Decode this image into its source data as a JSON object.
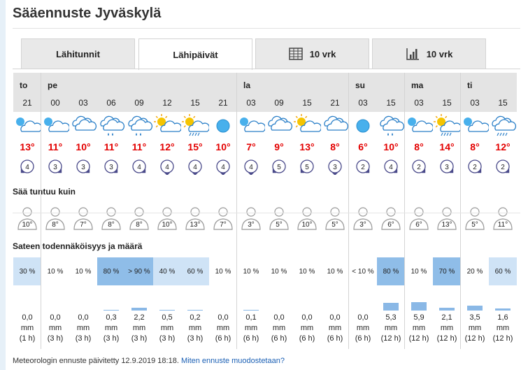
{
  "page": {
    "title": "Sääennuste Jyväskylä"
  },
  "tabs": [
    {
      "label": "Lähitunnit",
      "icon": "",
      "active": false
    },
    {
      "label": "Lähipäivät",
      "icon": "",
      "active": true
    },
    {
      "label": "10 vrk",
      "icon": "table-grid-icon",
      "active": false
    },
    {
      "label": "10 vrk",
      "icon": "bar-chart-icon",
      "active": false
    }
  ],
  "sections": {
    "feels_like": "Sää tuntuu kuin",
    "precipitation": "Sateen todennäköisyys ja määrä"
  },
  "days": [
    {
      "label": "to",
      "cols": 1
    },
    {
      "label": "pe",
      "cols": 7
    },
    {
      "label": "la",
      "cols": 4
    },
    {
      "label": "su",
      "cols": 2
    },
    {
      "label": "ma",
      "cols": 2
    },
    {
      "label": "ti",
      "cols": 2
    }
  ],
  "columns": [
    {
      "hour": "21",
      "icon": "night-cloudy-icon",
      "temp": "13°",
      "wind": "4",
      "wind_dir": 135,
      "feels": "10°",
      "prob": "30 %",
      "prob_level": 1,
      "amount": "0,0",
      "unit": "mm",
      "period": "(1 h)",
      "bar": 0
    },
    {
      "hour": "00",
      "icon": "night-partly-cloudy-icon",
      "temp": "11°",
      "wind": "3",
      "wind_dir": 45,
      "feels": "8°",
      "prob": "10 %",
      "prob_level": 0,
      "amount": "0,0",
      "unit": "mm",
      "period": "(3 h)",
      "bar": 0
    },
    {
      "hour": "03",
      "icon": "cloudy-icon",
      "temp": "10°",
      "wind": "3",
      "wind_dir": 45,
      "feels": "7°",
      "prob": "10 %",
      "prob_level": 0,
      "amount": "0,0",
      "unit": "mm",
      "period": "(3 h)",
      "bar": 0
    },
    {
      "hour": "06",
      "icon": "cloud-rain-icon",
      "temp": "11°",
      "wind": "3",
      "wind_dir": 45,
      "feels": "8°",
      "prob": "80 %",
      "prob_level": 2,
      "amount": "0,3",
      "unit": "mm",
      "period": "(3 h)",
      "bar": 0.3
    },
    {
      "hour": "09",
      "icon": "cloud-rain-icon",
      "temp": "11°",
      "wind": "4",
      "wind_dir": 45,
      "feels": "8°",
      "prob": "> 90 %",
      "prob_level": 2,
      "amount": "2,2",
      "unit": "mm",
      "period": "(3 h)",
      "bar": 2.2
    },
    {
      "hour": "12",
      "icon": "sun-cloud-icon",
      "temp": "12°",
      "wind": "4",
      "wind_dir": 90,
      "feels": "10°",
      "prob": "40 %",
      "prob_level": 1,
      "amount": "0,5",
      "unit": "mm",
      "period": "(3 h)",
      "bar": 0.5
    },
    {
      "hour": "15",
      "icon": "sun-showers-icon",
      "temp": "15°",
      "wind": "4",
      "wind_dir": 90,
      "feels": "13°",
      "prob": "60 %",
      "prob_level": 1,
      "amount": "0,2",
      "unit": "mm",
      "period": "(3 h)",
      "bar": 0.2
    },
    {
      "hour": "21",
      "icon": "night-clear-icon",
      "temp": "10°",
      "wind": "4",
      "wind_dir": 90,
      "feels": "7°",
      "prob": "10 %",
      "prob_level": 0,
      "amount": "0,0",
      "unit": "mm",
      "period": "(6 h)",
      "bar": 0
    },
    {
      "hour": "03",
      "icon": "night-partly-cloudy-icon",
      "temp": "7°",
      "wind": "4",
      "wind_dir": 90,
      "feels": "3°",
      "prob": "10 %",
      "prob_level": 0,
      "amount": "0,1",
      "unit": "mm",
      "period": "(6 h)",
      "bar": 0.1
    },
    {
      "hour": "09",
      "icon": "cloudy-icon",
      "temp": "9°",
      "wind": "5",
      "wind_dir": 135,
      "feels": "5°",
      "prob": "10 %",
      "prob_level": 0,
      "amount": "0,0",
      "unit": "mm",
      "period": "(6 h)",
      "bar": 0
    },
    {
      "hour": "15",
      "icon": "sun-cloud-icon",
      "temp": "13°",
      "wind": "5",
      "wind_dir": 135,
      "feels": "10°",
      "prob": "10 %",
      "prob_level": 0,
      "amount": "0,0",
      "unit": "mm",
      "period": "(6 h)",
      "bar": 0
    },
    {
      "hour": "21",
      "icon": "cloudy-icon",
      "temp": "8°",
      "wind": "3",
      "wind_dir": 90,
      "feels": "5°",
      "prob": "10 %",
      "prob_level": 0,
      "amount": "0,0",
      "unit": "mm",
      "period": "(6 h)",
      "bar": 0
    },
    {
      "hour": "03",
      "icon": "night-clear-icon",
      "temp": "6°",
      "wind": "2",
      "wind_dir": 45,
      "feels": "3°",
      "prob": "< 10 %",
      "prob_level": 0,
      "amount": "0,0",
      "unit": "mm",
      "period": "(6 h)",
      "bar": 0
    },
    {
      "hour": "15",
      "icon": "cloud-rain-icon",
      "temp": "10°",
      "wind": "4",
      "wind_dir": 45,
      "feels": "6°",
      "prob": "80 %",
      "prob_level": 2,
      "amount": "5,3",
      "unit": "mm",
      "period": "(12 h)",
      "bar": 5.3
    },
    {
      "hour": "03",
      "icon": "night-partly-cloudy-icon",
      "temp": "8°",
      "wind": "2",
      "wind_dir": 45,
      "feels": "6°",
      "prob": "10 %",
      "prob_level": 0,
      "amount": "5,9",
      "unit": "mm",
      "period": "(12 h)",
      "bar": 5.9
    },
    {
      "hour": "15",
      "icon": "sun-showers-icon",
      "temp": "14°",
      "wind": "3",
      "wind_dir": 45,
      "feels": "13°",
      "prob": "70 %",
      "prob_level": 2,
      "amount": "2,1",
      "unit": "mm",
      "period": "(12 h)",
      "bar": 2.1
    },
    {
      "hour": "03",
      "icon": "night-cloudy-icon",
      "temp": "8°",
      "wind": "2",
      "wind_dir": 45,
      "feels": "5°",
      "prob": "20 %",
      "prob_level": 0,
      "amount": "3,5",
      "unit": "mm",
      "period": "(12 h)",
      "bar": 3.5
    },
    {
      "hour": "15",
      "icon": "cloud-showers-icon",
      "temp": "12°",
      "wind": "2",
      "wind_dir": 45,
      "feels": "11°",
      "prob": "60 %",
      "prob_level": 1,
      "amount": "1,6",
      "unit": "mm",
      "period": "(12 h)",
      "bar": 1.6
    }
  ],
  "colors": {
    "temp": "#e30000",
    "prob_low": "#ffffff",
    "prob_mid": "#cfe3f6",
    "prob_high": "#8fbde8",
    "bar": "#8ab8e6",
    "header": "#e4e4e4"
  },
  "footer": {
    "text": "Meteorologin ennuste päivitetty 12.9.2019 18:18.",
    "link": "Miten ennuste muodostetaan?"
  }
}
